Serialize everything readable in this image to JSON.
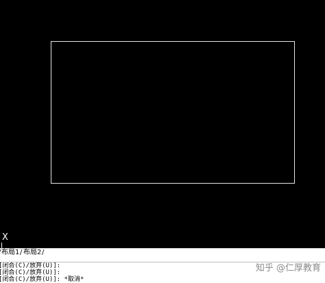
{
  "ucs": {
    "x_label": "X"
  },
  "layout_tabs": [
    {
      "label": "布局1"
    },
    {
      "label": "布局2"
    }
  ],
  "tab_separator": "/",
  "command_history": [
    "[闭合(C)/放弃(U)]:",
    "[闭合(C)/放弃(U)]:",
    "[闭合(C)/放弃(U)]: *取消*"
  ],
  "watermark": "知乎 @仁厚教育",
  "colors": {
    "canvas_background": "#000000",
    "geometry_stroke": "#e6e6e6",
    "command_background": "#ffffff"
  }
}
